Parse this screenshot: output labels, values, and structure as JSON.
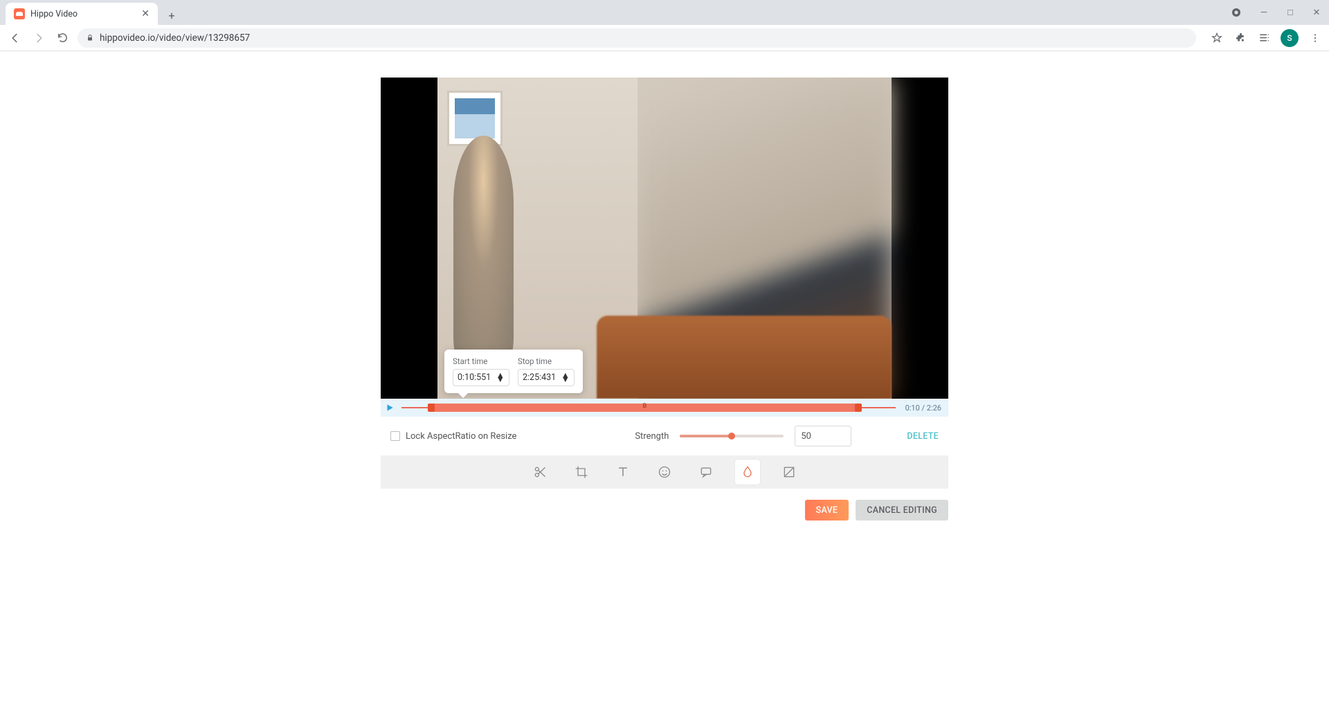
{
  "browser": {
    "tab_title": "Hippo Video",
    "url": "hippovideo.io/video/view/13298657",
    "avatar_initial": "S"
  },
  "tooltip": {
    "start_label": "Start time",
    "start_value": "0:10:551",
    "stop_label": "Stop time",
    "stop_value": "2:25:431"
  },
  "timeline": {
    "range_label": "B",
    "current": "0:10",
    "total": "2:26"
  },
  "options": {
    "lock_label": "Lock AspectRatio on Resize",
    "strength_label": "Strength",
    "strength_value": "50",
    "delete_label": "DELETE"
  },
  "footer": {
    "save": "SAVE",
    "cancel": "CANCEL EDITING"
  }
}
